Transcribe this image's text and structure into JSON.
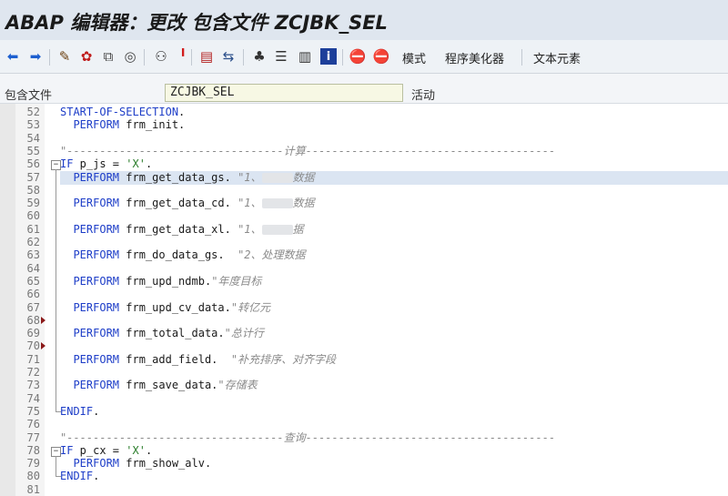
{
  "title": "ABAP 编辑器：更改 包含文件 ZCJBK_SEL",
  "toolbar": {
    "btn_pretty_mode": "模式",
    "btn_pretty_print": "程序美化器",
    "btn_text_elements": "文本元素",
    "icons": [
      "back-arrow-icon",
      "forward-arrow-icon",
      "check-syntax-icon",
      "activate-icon",
      "test-icon",
      "where-used-icon",
      "object-list-icon",
      "navigation-icon",
      "display-object-list-icon",
      "enhance-icon",
      "hierarchy-icon",
      "list-icon",
      "info-icon",
      "breakpoint-session-icon",
      "breakpoint-external-icon"
    ]
  },
  "field": {
    "label": "包含文件",
    "value": "ZCJBK_SEL",
    "status": "活动"
  },
  "editor": {
    "lines": [
      {
        "n": "52",
        "t": "START-OF-SELECTION."
      },
      {
        "n": "53",
        "t": "  PERFORM frm_init."
      },
      {
        "n": "54",
        "t": ""
      },
      {
        "n": "55",
        "t": "\"---------------------------------计算--------------------------------------"
      },
      {
        "n": "56",
        "t": "IF p_js = 'X'."
      },
      {
        "n": "57",
        "t": "  PERFORM frm_get_data_gs. \"1、      数据"
      },
      {
        "n": "58",
        "t": ""
      },
      {
        "n": "59",
        "t": "  PERFORM frm_get_data_cd. \"1、      数据"
      },
      {
        "n": "60",
        "t": ""
      },
      {
        "n": "61",
        "t": "  PERFORM frm_get_data_xl. \"1、      据"
      },
      {
        "n": "62",
        "t": ""
      },
      {
        "n": "63",
        "t": "  PERFORM frm_do_data_gs.  \"2、处理数据"
      },
      {
        "n": "64",
        "t": ""
      },
      {
        "n": "65",
        "t": "  PERFORM frm_upd_ndmb.\"年度目标"
      },
      {
        "n": "66",
        "t": ""
      },
      {
        "n": "67",
        "t": "  PERFORM frm_upd_cv_data.\"转亿元"
      },
      {
        "n": "68",
        "t": ""
      },
      {
        "n": "69",
        "t": "  PERFORM frm_total_data.\"总计行"
      },
      {
        "n": "70",
        "t": ""
      },
      {
        "n": "71",
        "t": "  PERFORM frm_add_field.  \"补充排序、对齐字段"
      },
      {
        "n": "72",
        "t": ""
      },
      {
        "n": "73",
        "t": "  PERFORM frm_save_data.\"存储表"
      },
      {
        "n": "74",
        "t": ""
      },
      {
        "n": "75",
        "t": "ENDIF."
      },
      {
        "n": "76",
        "t": ""
      },
      {
        "n": "77",
        "t": "\"---------------------------------查询--------------------------------------"
      },
      {
        "n": "78",
        "t": "IF p_cx = 'X'."
      },
      {
        "n": "79",
        "t": "  PERFORM frm_show_alv."
      },
      {
        "n": "80",
        "t": "ENDIF."
      },
      {
        "n": "81",
        "t": ""
      }
    ]
  },
  "colors": {
    "keyword": "#1e3ec8",
    "string": "#2a7d2a",
    "comment": "#8a8a8a",
    "highlight": "#dbe5f2",
    "breakpoint": "#8b1a1a"
  }
}
